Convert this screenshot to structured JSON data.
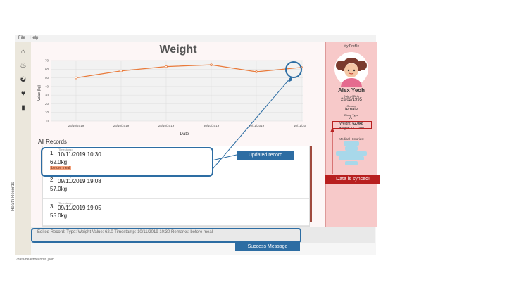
{
  "menu": {
    "file": "File",
    "help": "Help"
  },
  "sidebar": {
    "label": "Health Records",
    "icons": [
      "home-icon",
      "food-icon",
      "exercise-icon",
      "health-icon",
      "records-icon"
    ]
  },
  "main": {
    "title": "Weight",
    "records_title": "All Records"
  },
  "chart_data": {
    "type": "line",
    "x": [
      "23/10/2019",
      "26/10/2019",
      "28/10/2019",
      "30/10/2019",
      "09/11/2019",
      "10/11/2019"
    ],
    "values": [
      50,
      58,
      63,
      65,
      57,
      62
    ],
    "xlabel": "Date",
    "ylabel": "Value (kg)",
    "ylim": [
      0,
      70
    ],
    "yticks": [
      "0",
      "10",
      "20",
      "30",
      "40",
      "50",
      "60",
      "70"
    ],
    "grid": true,
    "color": "#e97a3a"
  },
  "records": [
    {
      "index": "1.",
      "timestamp_label": "Timestamp:",
      "timestamp": "10/11/2019 10:30",
      "value": "62.0kg",
      "remark": "before meal"
    },
    {
      "index": "2.",
      "timestamp_label": "Timestamp:",
      "timestamp": "09/11/2019 19:08",
      "value": "57.0kg",
      "remark": ""
    },
    {
      "index": "3.",
      "timestamp_label": "Timestamp:",
      "timestamp": "09/11/2019 19:05",
      "value": "55.0kg",
      "remark": ""
    }
  ],
  "status": {
    "message": "Edited Record: Type: Weight Value: 62.0 Timestamp: 10/11/2019 10:30 Remarks: before meal"
  },
  "footer": {
    "path": "./data/healthrecords.json"
  },
  "profile": {
    "heading": "My Profile",
    "name": "Alex Yeoh",
    "dob_label": "Date of Birth",
    "dob": "23/02/1995",
    "gender_label": "Gender",
    "gender": "female",
    "blood_label": "Blood Type",
    "blood": "A-",
    "weight_label": "Weight:",
    "weight": "62.0kg",
    "height_label": "Height:",
    "height": "172.0cm",
    "medical_label": "Medical Histories:"
  },
  "annotations": {
    "updated_record": "Updated record",
    "data_synced": "Data is synced!",
    "success": "Success Message"
  },
  "colors": {
    "accent": "#2d6da3",
    "synced": "#b81f1f",
    "line": "#e97a3a",
    "profile_bg": "#f7c9c9"
  }
}
